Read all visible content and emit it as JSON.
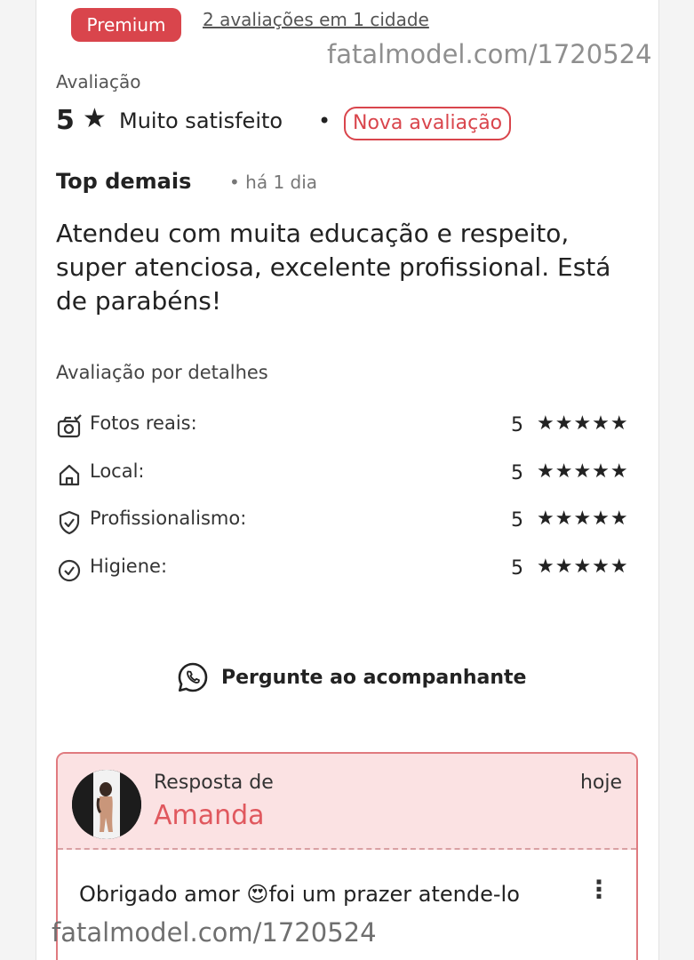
{
  "header": {
    "badge": "Premium",
    "reviews_link": "2 avaliações em 1 cidade",
    "watermark": "fatalmodel.com/1720524"
  },
  "rating": {
    "section_label": "Avaliação",
    "value": "5",
    "star": "★",
    "text": "Muito satisfeito",
    "separator": "•",
    "badge": "Nova avaliação"
  },
  "review": {
    "title": "Top demais",
    "time": "• há 1 dia",
    "body": "Atendeu com muita educação e respeito, super atenciosa, excelente profissional. Está de parabéns!"
  },
  "details": {
    "title": "Avaliação por detalhes",
    "items": [
      {
        "icon": "camera-icon",
        "label": "Fotos reais:",
        "score": "5",
        "stars": "★★★★★"
      },
      {
        "icon": "home-icon",
        "label": "Local:",
        "score": "5",
        "stars": "★★★★★"
      },
      {
        "icon": "shield-check-icon",
        "label": "Profissionalismo:",
        "score": "5",
        "stars": "★★★★★"
      },
      {
        "icon": "check-circle-icon",
        "label": "Higiene:",
        "score": "5",
        "stars": "★★★★★"
      }
    ]
  },
  "ask": {
    "icon": "whatsapp-icon",
    "label": "Pergunte ao acompanhante"
  },
  "reply": {
    "from_label": "Resposta de",
    "name": "Amanda",
    "time": "hoje",
    "text_before": "Obrigado amor ",
    "emoji": "😍",
    "text_after": "foi um prazer atende-lo",
    "more": "⋮"
  },
  "footer": {
    "watermark": "fatalmodel.com/1720524"
  },
  "colors": {
    "accent": "#d9454c",
    "reply_bg": "#fbe2e3",
    "name": "#e0585e"
  }
}
